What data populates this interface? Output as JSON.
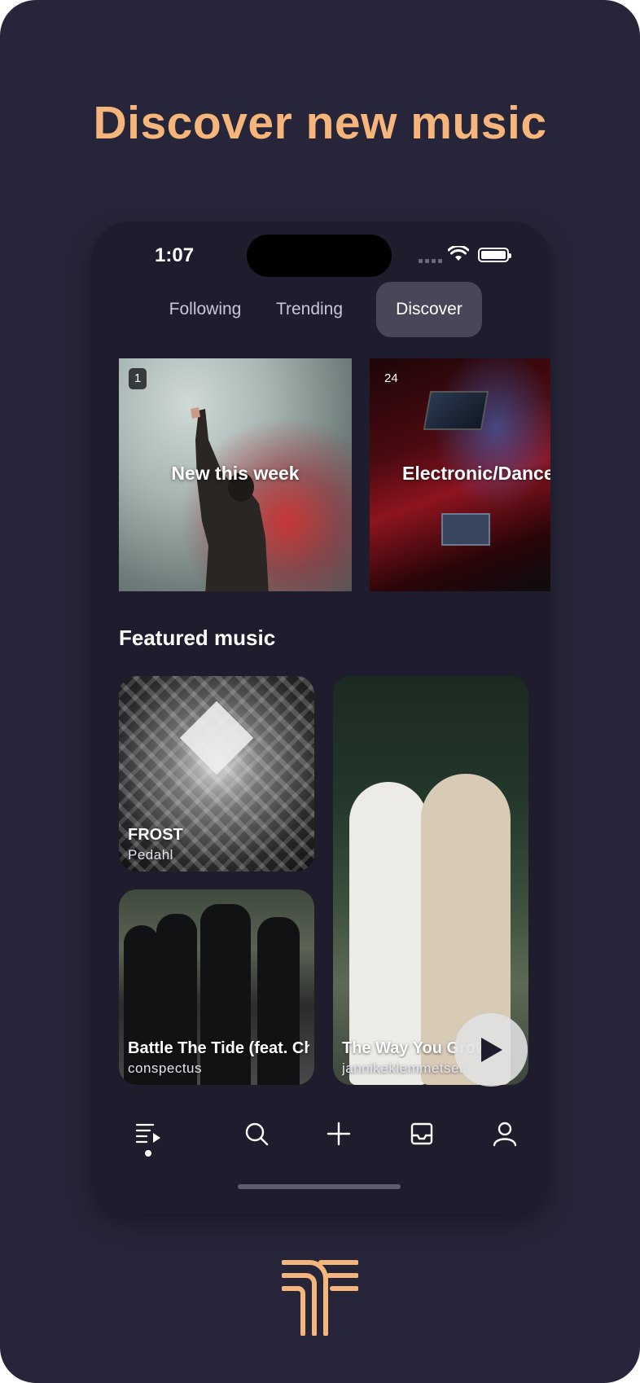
{
  "headline": "Discover new music",
  "status_bar": {
    "time": "1:07"
  },
  "tabs": [
    {
      "label": "Following",
      "active": false
    },
    {
      "label": "Trending",
      "active": false
    },
    {
      "label": "Discover",
      "active": true
    }
  ],
  "carousel": [
    {
      "badge": "1",
      "title": "New this week"
    },
    {
      "badge": "24",
      "title": "Electronic/Dance"
    }
  ],
  "featured": {
    "title": "Featured music",
    "tracks": [
      {
        "title": "FROST",
        "artist": "Pedahl"
      },
      {
        "title": "Battle The Tide (feat. Ch...",
        "artist": "conspectus"
      },
      {
        "title": "The Way You Grow",
        "artist": "jannikeklemmetsen"
      }
    ]
  },
  "bottom_nav": [
    "feed-icon",
    "search-icon",
    "plus-icon",
    "inbox-icon",
    "profile-icon"
  ],
  "colors": {
    "background": "#272539",
    "phone": "#1f1d2d",
    "accent": "#f6b57a",
    "active_tab": "#48475a"
  }
}
